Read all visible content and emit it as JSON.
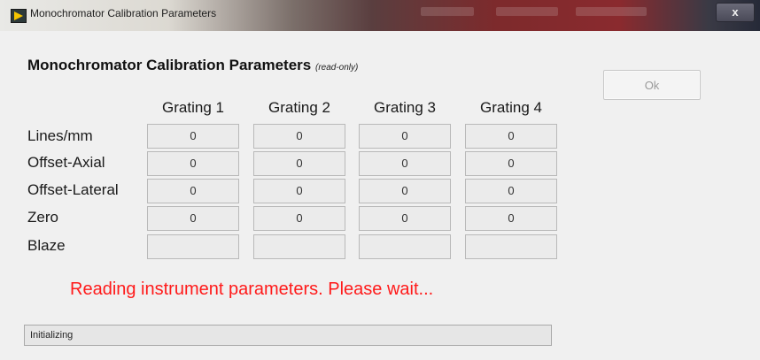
{
  "window": {
    "title": "Monochromator Calibration Parameters",
    "close_label": "x"
  },
  "panel": {
    "heading": "Monochromator Calibration Parameters",
    "heading_note": "(read-only)",
    "ok_label": "Ok"
  },
  "table": {
    "columns": [
      "Grating 1",
      "Grating 2",
      "Grating 3",
      "Grating 4"
    ],
    "rows": [
      {
        "label": "Lines/mm",
        "values": [
          "0",
          "0",
          "0",
          "0"
        ]
      },
      {
        "label": "Offset-Axial",
        "values": [
          "0",
          "0",
          "0",
          "0"
        ]
      },
      {
        "label": "Offset-Lateral",
        "values": [
          "0",
          "0",
          "0",
          "0"
        ]
      },
      {
        "label": "Zero",
        "values": [
          "0",
          "0",
          "0",
          "0"
        ]
      },
      {
        "label": "Blaze",
        "values": [
          "",
          "",
          "",
          ""
        ]
      }
    ]
  },
  "status": {
    "message": "Reading instrument parameters.  Please wait...",
    "message_color": "#ff1a1a",
    "progress_text": "Initializing"
  },
  "icons": {
    "window_icon": "labview-app-icon",
    "close_icon": "close-icon"
  }
}
